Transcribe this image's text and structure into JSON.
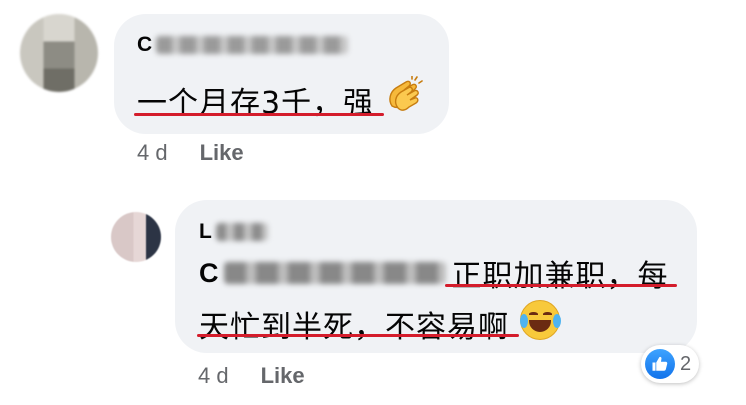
{
  "comments": [
    {
      "author_initial": "C",
      "text": "一个月存3千，强",
      "emoji": "clapping-hands",
      "time": "4 d",
      "like_label": "Like"
    },
    {
      "author_initial": "L",
      "mention_initial": "C",
      "text_line1": "正职加兼职，每",
      "text_line2": "天忙到半死，不容易啊",
      "emoji": "face-with-tears-of-joy",
      "time": "4 d",
      "like_label": "Like",
      "reaction_count": "2",
      "reaction_type": "like"
    }
  ],
  "colors": {
    "bubble": "#f0f2f5",
    "underline": "#d41c2b",
    "meta_text": "#65676b",
    "like_blue": "#1877f2"
  }
}
